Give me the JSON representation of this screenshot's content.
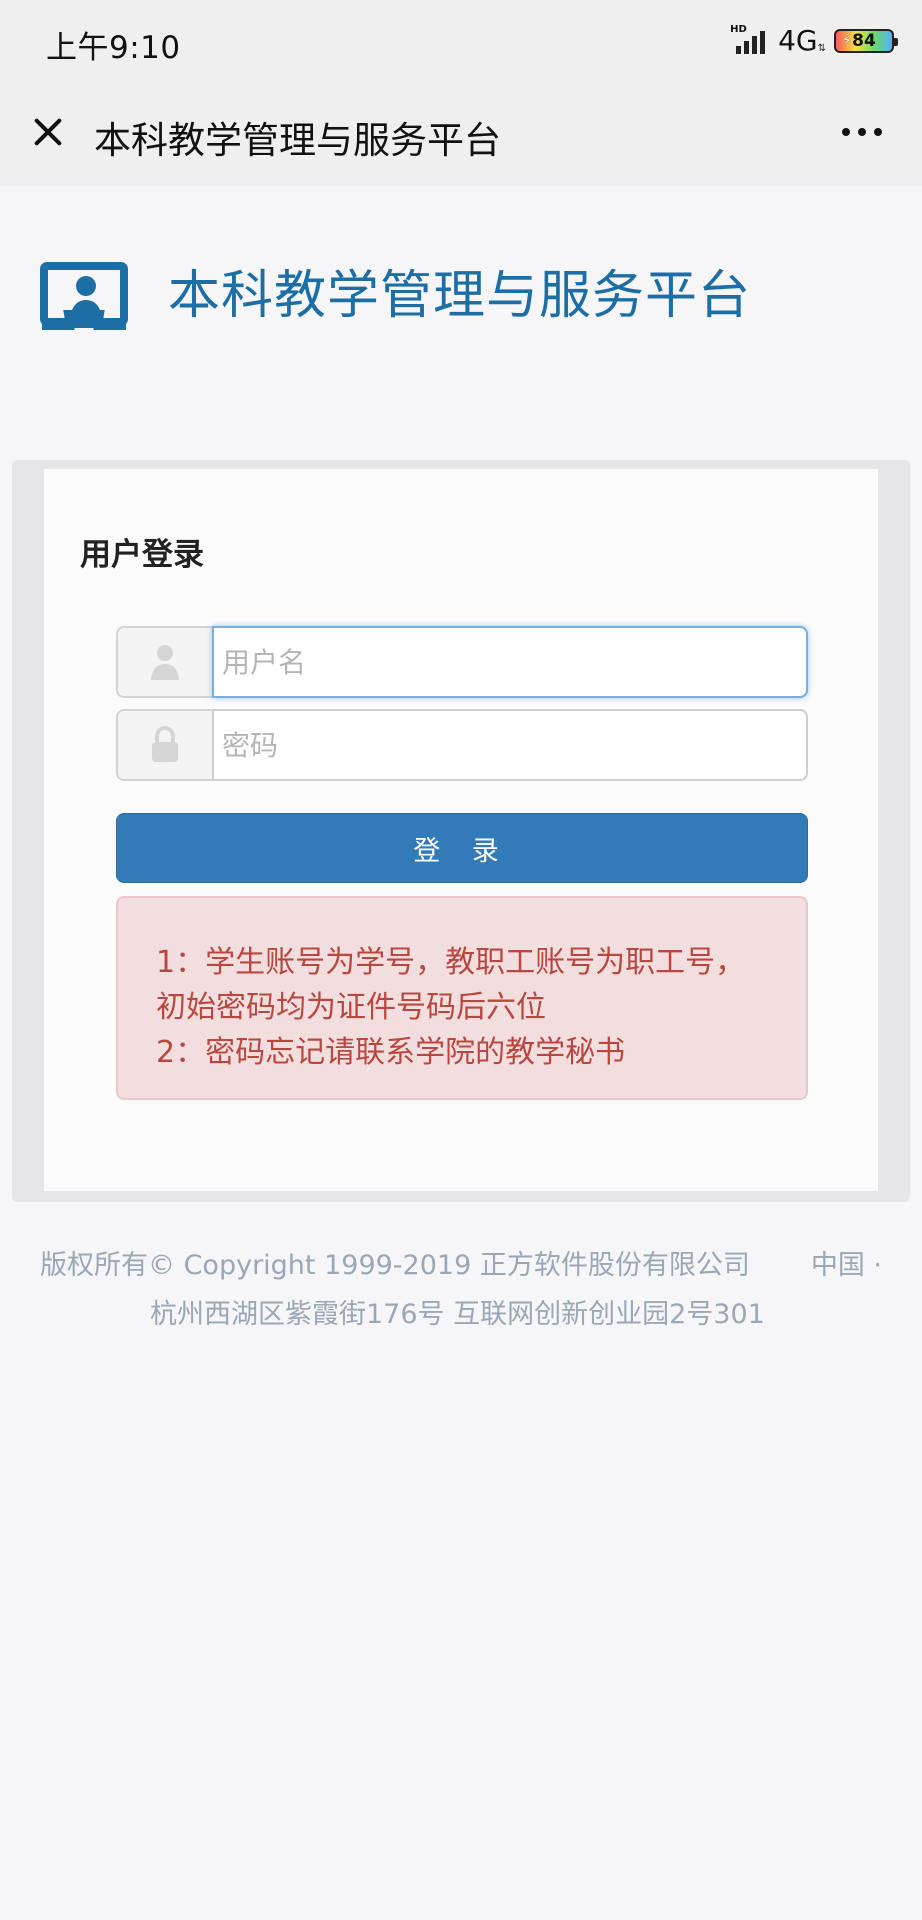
{
  "status_bar": {
    "time": "上午9:10",
    "hd": "HD",
    "network": "4G",
    "battery": "84",
    "icons": [
      "signal-icon",
      "battery-icon",
      "charging-icon"
    ]
  },
  "navbar": {
    "title": "本科教学管理与服务平台",
    "icons": [
      "close-icon",
      "more-icon"
    ]
  },
  "hero": {
    "title": "本科教学管理与服务平台",
    "logo_icon": "teaching-platform-logo-icon"
  },
  "login": {
    "heading": "用户登录",
    "username_placeholder": "用户名",
    "password_placeholder": "密码",
    "button_label": "登 录",
    "notice_lines": [
      "1：学生账号为学号，教职工账号为职工号，初始密码均为证件号码后六位",
      "2：密码忘记请联系学院的教学秘书"
    ],
    "icons": [
      "user-icon",
      "lock-icon"
    ]
  },
  "footer": {
    "line1_left": "版权所有© Copyright 1999-2019 正方软件股份有限公司",
    "line1_right": "中国 ·",
    "line2": "杭州西湖区紫霞街176号 互联网创新创业园2号301"
  },
  "colors": {
    "page_background": "#f6f6f8",
    "header_background": "#efefef",
    "brand_blue": "#1d6ea5",
    "button_blue": "#327bb8",
    "notice_background": "#f3dedf",
    "notice_text": "#b8483f",
    "footer_text": "#9aa7b7"
  }
}
